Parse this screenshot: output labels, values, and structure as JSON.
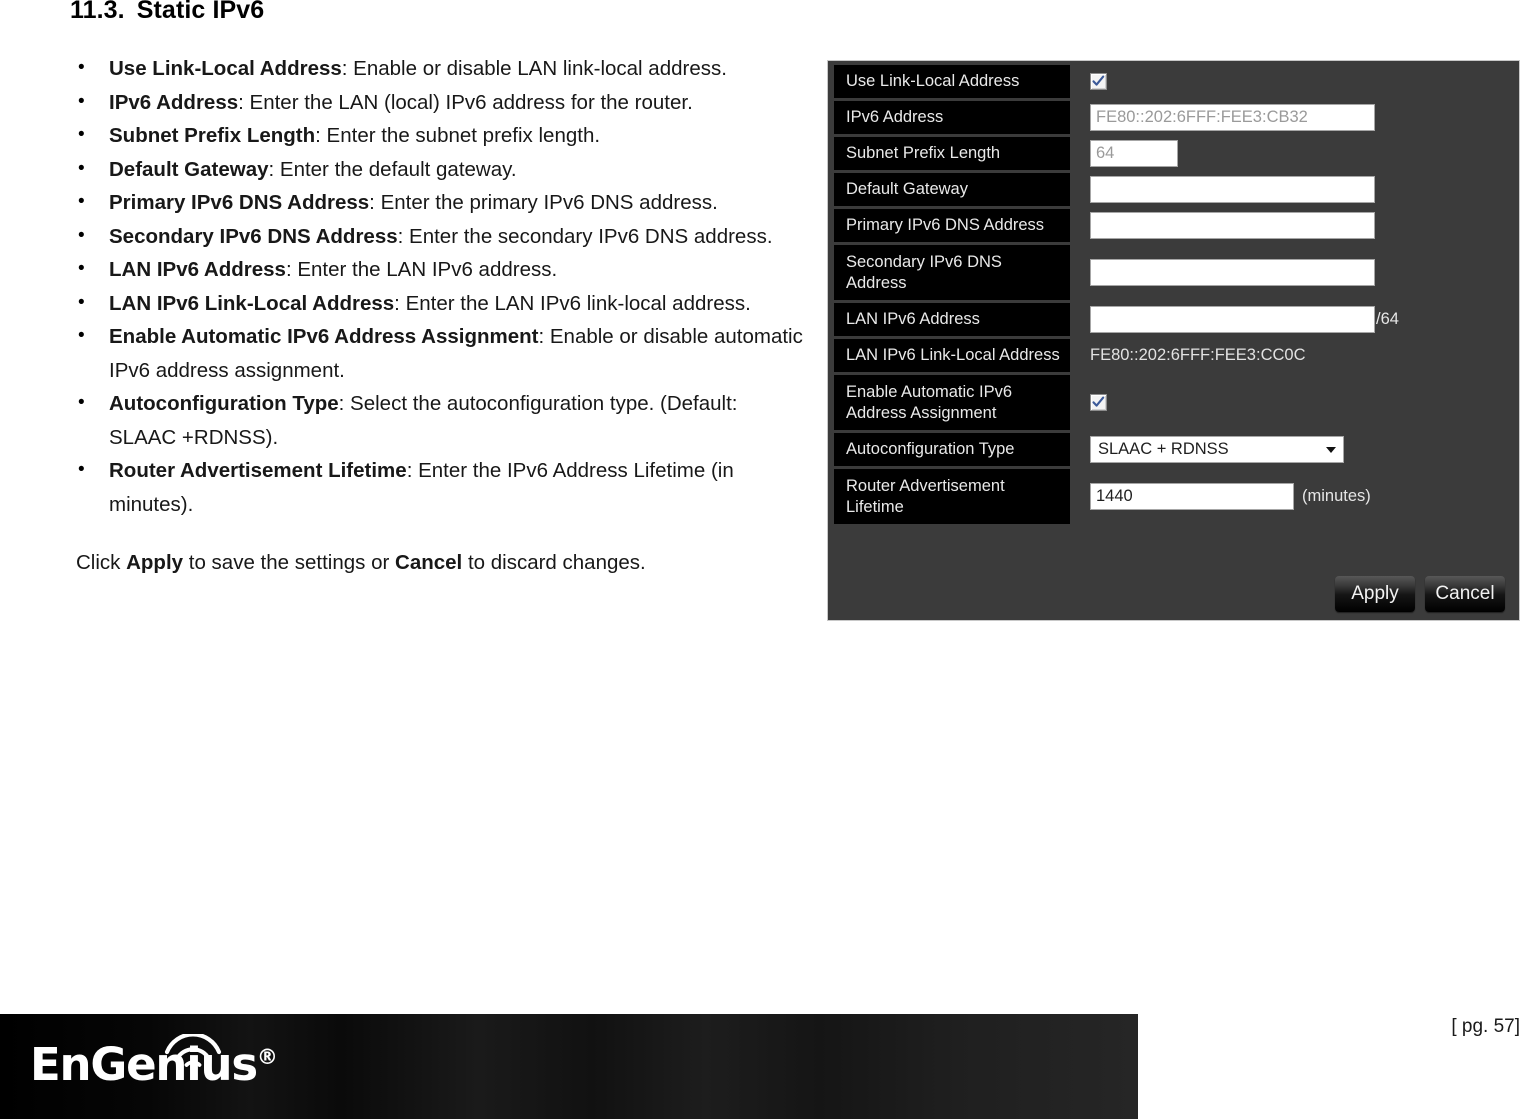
{
  "document": {
    "heading_number": "11.3.",
    "heading_title": "Static IPv6",
    "bullets": [
      {
        "term": "Use Link-Local Address",
        "desc": ": Enable or disable LAN link-local address."
      },
      {
        "term": "IPv6 Address",
        "desc": ": Enter the LAN (local) IPv6 address for the router."
      },
      {
        "term": "Subnet Prefix Length",
        "desc": ": Enter the subnet prefix length."
      },
      {
        "term": "Default Gateway",
        "desc": ": Enter the default gateway."
      },
      {
        "term": "Primary IPv6 DNS Address",
        "desc": ": Enter the primary IPv6 DNS address."
      },
      {
        "term": "Secondary IPv6 DNS Address",
        "desc": ": Enter the secondary IPv6 DNS address."
      },
      {
        "term": "LAN IPv6 Address",
        "desc": ": Enter the LAN IPv6 address."
      },
      {
        "term": "LAN IPv6 Link-Local Address",
        "desc": ": Enter the LAN IPv6 link-local address."
      },
      {
        "term": "Enable Automatic IPv6 Address Assignment",
        "desc": ": Enable or disable automatic IPv6 address assignment."
      },
      {
        "term": "Autoconfiguration Type",
        "desc": ": Select the autoconfiguration type. (Default: SLAAC +RDNSS)."
      },
      {
        "term": "Router Advertisement Lifetime",
        "desc": ": Enter the IPv6 Address Lifetime (in minutes)."
      }
    ],
    "click_note": {
      "prefix": "Click ",
      "apply": "Apply",
      "middle": " to save the settings or ",
      "cancel": "Cancel",
      "suffix": " to discard changes."
    }
  },
  "router_ui": {
    "rows": [
      {
        "label": "Use Link-Local Address",
        "type": "checkbox",
        "checked": true
      },
      {
        "label": "IPv6 Address",
        "type": "text",
        "value": "FE80::202:6FFF:FEE3:CB32",
        "ghost": true,
        "width": "wide"
      },
      {
        "label": "Subnet Prefix Length",
        "type": "text",
        "value": "64",
        "ghost": true,
        "width": "small"
      },
      {
        "label": "Default Gateway",
        "type": "text",
        "value": "",
        "width": "wide"
      },
      {
        "label": "Primary IPv6 DNS Address",
        "type": "text",
        "value": "",
        "width": "wide"
      },
      {
        "label": "Secondary IPv6 DNS Address",
        "label_line1": "Secondary IPv6 DNS",
        "label_line2": "Address",
        "type": "text",
        "value": "",
        "width": "wide"
      },
      {
        "label": "LAN IPv6 Address",
        "type": "text",
        "value": "",
        "width": "wide",
        "suffix": "/64"
      },
      {
        "label": "LAN IPv6 Link-Local Address",
        "type": "static",
        "value": "FE80::202:6FFF:FEE3:CC0C"
      },
      {
        "label": "Enable Automatic IPv6 Address Assignment",
        "label_line1": "Enable Automatic IPv6",
        "label_line2": "Address Assignment",
        "type": "checkbox",
        "checked": true
      },
      {
        "label": "Autoconfiguration Type",
        "type": "select",
        "value": "SLAAC + RDNSS"
      },
      {
        "label": "Router Advertisement Lifetime",
        "label_line1": "Router Advertisement",
        "label_line2": "Lifetime",
        "type": "text",
        "value": "1440",
        "width": "med",
        "suffix": "(minutes)"
      }
    ],
    "labels": {
      "use_link_local": "Use Link-Local Address",
      "ipv6_address": "IPv6 Address",
      "subnet_prefix_length": "Subnet Prefix Length",
      "default_gateway": "Default Gateway",
      "primary_dns": "Primary IPv6 DNS Address",
      "secondary_dns_l1": "Secondary IPv6 DNS",
      "secondary_dns_l2": "Address",
      "lan_ipv6_address": "LAN IPv6 Address",
      "lan_link_local": "LAN IPv6 Link-Local Address",
      "auto_assign_l1": "Enable Automatic IPv6",
      "auto_assign_l2": "Address Assignment",
      "autoconfig_type": "Autoconfiguration Type",
      "ra_lifetime_l1": "Router Advertisement",
      "ra_lifetime_l2": "Lifetime"
    },
    "values": {
      "ipv6_address": "FE80::202:6FFF:FEE3:CB32",
      "subnet_prefix_length": "64",
      "default_gateway": "",
      "primary_dns": "",
      "secondary_dns": "",
      "lan_ipv6_address": "",
      "lan_ipv6_suffix": "/64",
      "lan_link_local": "FE80::202:6FFF:FEE3:CC0C",
      "autoconfig_type": "SLAAC + RDNSS",
      "ra_lifetime": "1440",
      "ra_lifetime_unit": "(minutes)"
    },
    "buttons": {
      "apply": "Apply",
      "cancel": "Cancel"
    },
    "colors": {
      "panel_bg": "#3b3b3b",
      "label_bg": "#000000",
      "label_text": "#e9e9e9",
      "input_bg": "#ffffff",
      "ghost_text": "#9a9a9a"
    }
  },
  "footer": {
    "brand": "EnGenius",
    "brand_mark": "®",
    "page_label": "[ pg. 57]"
  }
}
